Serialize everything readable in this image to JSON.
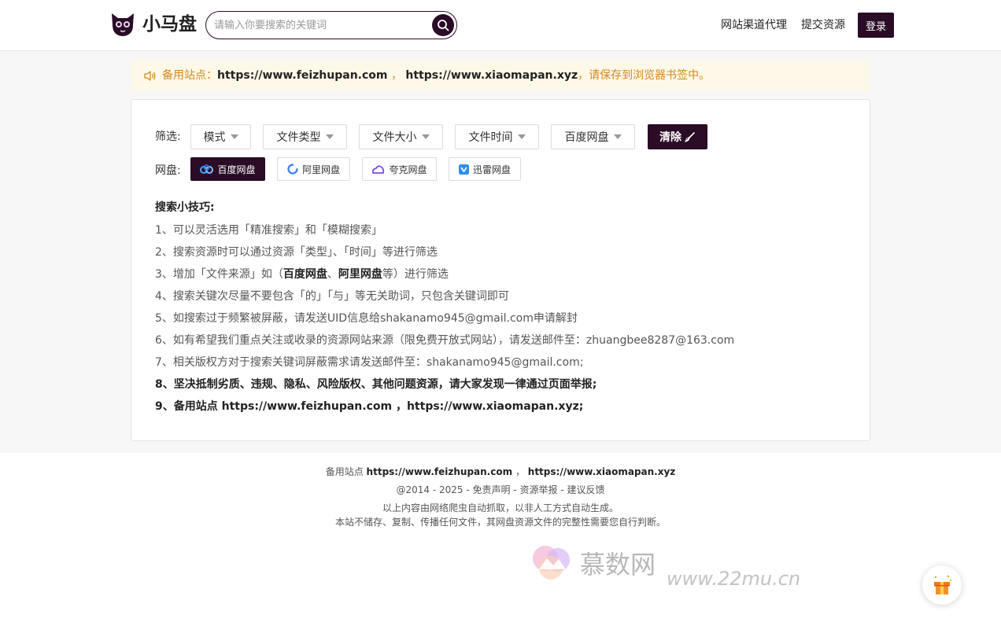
{
  "header": {
    "logo_text": "小马盘",
    "search_placeholder": "请输入你要搜索的关键词",
    "nav": [
      "网站渠道代理",
      "提交资源"
    ],
    "login_label": "登录"
  },
  "notice": {
    "prefix": "备用站点：",
    "site1": "https://www.feizhupan.com",
    "sep": "，",
    "site2": "https://www.xiaomapan.xyz",
    "suffix": "，请保存到浏览器书签中。"
  },
  "filters": {
    "label": "筛选:",
    "dropdowns": [
      "模式",
      "文件类型",
      "文件大小",
      "文件时间",
      "百度网盘"
    ],
    "clear_label": "清除"
  },
  "pans": {
    "label": "网盘:",
    "items": [
      "百度网盘",
      "阿里网盘",
      "夸克网盘",
      "迅雷网盘"
    ],
    "active_index": 0
  },
  "tips": {
    "title": "搜索小技巧:",
    "items": [
      "1、可以灵活选用「精准搜索」和「模糊搜索」",
      "2、搜索资源时可以通过资源「类型」、「时间」等进行筛选",
      "4、搜索关键次尽量不要包含「的」「与」等无关助词，只包含关键词即可",
      "5、如搜索过于频繁被屏蔽，请发送UID信息给shakanamo945@gmail.com申请解封",
      "6、如有希望我们重点关注或收录的资源网站来源（限免费开放式网站），请发送邮件至：zhuangbee8287@163.com",
      "7、相关版权方对于搜索关键词屏蔽需求请发送邮件至：shakanamo945@gmail.com;",
      "8、坚决抵制劣质、违规、隐私、风险版权、其他问题资源，请大家发现一律通过页面举报;",
      "9、备用站点 https://www.feizhupan.com ，https://www.xiaomapan.xyz;"
    ],
    "tip3": {
      "a": "3、增加「文件来源」如（",
      "b": "百度网盘",
      "c": "、",
      "d": "阿里网盘",
      "e": "等）进行筛选"
    }
  },
  "footer": {
    "backup_label": "备用站点",
    "site1": "https://www.feizhupan.com",
    "sep": "，",
    "site2": "https://www.xiaomapan.xyz",
    "links_line": "@2014 - 2025 - 免责声明 - 资源举报 - 建议反馈",
    "line3": "以上内容由网络爬虫自动抓取，以非人工方式自动生成。",
    "line4": "本站不储存、复制、传播任何文件，其网盘资源文件的完整性需要您自行判断。"
  },
  "watermark": {
    "text": "慕数网",
    "url": "www.22mu.cn"
  },
  "colors": {
    "brand": "#2a0c26",
    "notice_text": "#d28a21",
    "notice_bg": "#fef8e8"
  }
}
